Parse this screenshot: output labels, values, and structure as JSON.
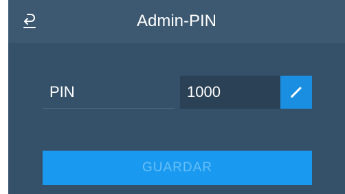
{
  "header": {
    "title": "Admin-PIN",
    "back_icon": "back-arrow-icon"
  },
  "form": {
    "pin_label": "PIN",
    "pin_value": "1000",
    "edit_icon": "pencil-icon"
  },
  "actions": {
    "save_label": "GUARDAR"
  },
  "colors": {
    "background": "#355069",
    "header": "#3d5972",
    "field": "#2a4156",
    "accent": "#1a8fe2",
    "save_button": "#199af0",
    "save_text_disabled": "#68bff7"
  }
}
